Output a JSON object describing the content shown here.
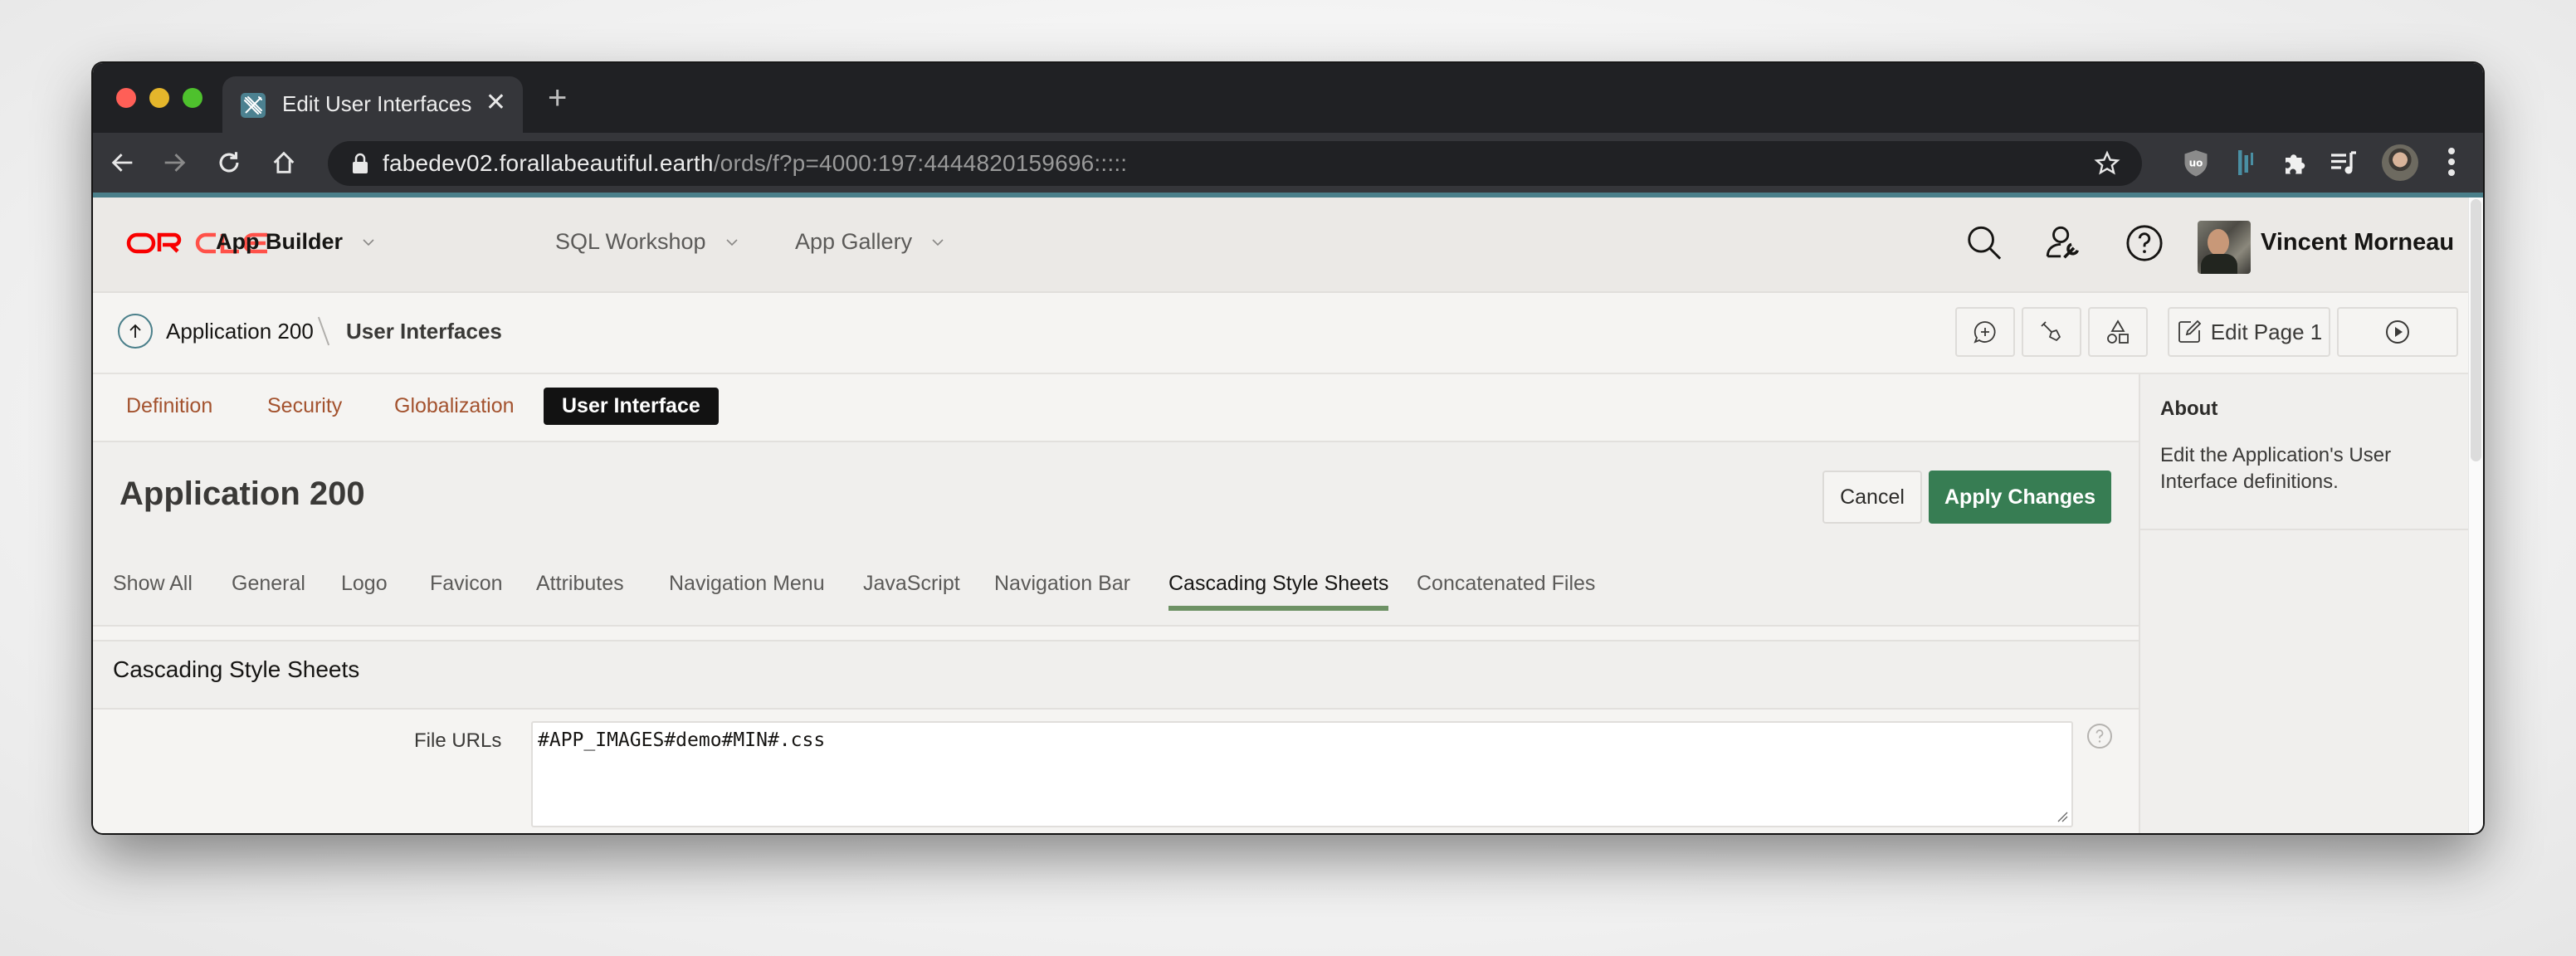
{
  "browser": {
    "tab_title": "Edit User Interfaces",
    "tab_icon": "apex-builder-icon",
    "url_host": "fabedev02.forallabeautiful.earth",
    "url_path": "/ords/f?p=4000:197:4444820159696:::::",
    "extensions": [
      "ublock-origin-icon",
      "extension-bars-icon",
      "extensions-puzzle-icon",
      "media-queue-icon"
    ]
  },
  "header": {
    "logo_text": "ORACLE",
    "brand_color": "#f80000",
    "menus": [
      {
        "label": "App Builder",
        "active": true
      },
      {
        "label": "SQL Workshop",
        "active": false
      },
      {
        "label": "App Gallery",
        "active": false
      }
    ],
    "user_name": "Vincent Morneau"
  },
  "breadcrumb": {
    "parent": "Application 200",
    "current": "User Interfaces"
  },
  "toolbar": {
    "edit_page_label": "Edit Page 1"
  },
  "main_tabs": [
    {
      "label": "Definition",
      "active": false
    },
    {
      "label": "Security",
      "active": false
    },
    {
      "label": "Globalization",
      "active": false
    },
    {
      "label": "User Interface",
      "active": true
    }
  ],
  "page": {
    "title": "Application 200",
    "cancel_label": "Cancel",
    "apply_label": "Apply Changes",
    "accent_color": "#377d53"
  },
  "sub_tabs": [
    {
      "label": "Show All",
      "active": false
    },
    {
      "label": "General",
      "active": false
    },
    {
      "label": "Logo",
      "active": false
    },
    {
      "label": "Favicon",
      "active": false
    },
    {
      "label": "Attributes",
      "active": false
    },
    {
      "label": "Navigation Menu",
      "active": false
    },
    {
      "label": "JavaScript",
      "active": false
    },
    {
      "label": "Navigation Bar",
      "active": false
    },
    {
      "label": "Cascading Style Sheets",
      "active": true
    },
    {
      "label": "Concatenated Files",
      "active": false
    }
  ],
  "region": {
    "title": "Cascading Style Sheets",
    "fields": [
      {
        "label": "File URLs",
        "value": "#APP_IMAGES#demo#MIN#.css"
      }
    ]
  },
  "about": {
    "title": "About",
    "text": "Edit the Application's User Interface definitions."
  }
}
